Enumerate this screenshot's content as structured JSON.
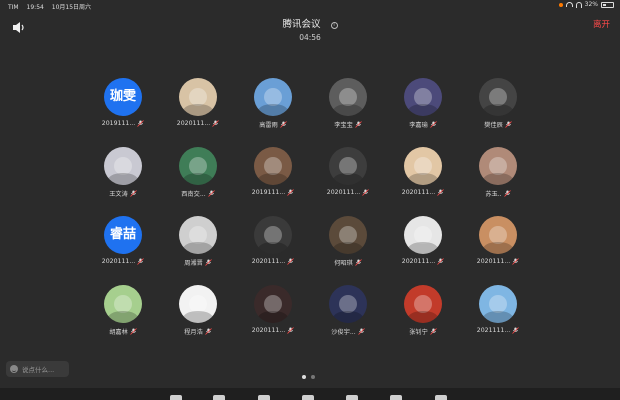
{
  "status": {
    "carrier": "TIM",
    "time": "19:54",
    "date": "10月15日周六",
    "battery": "32%"
  },
  "meeting": {
    "title": "腾讯会议",
    "timer": "04:56",
    "leave_label": "离开",
    "info_glyph": "i"
  },
  "colors": {
    "leave": "#ff4a4a",
    "initials_bg": "#1f72f0",
    "background": "#2b2b2b"
  },
  "participants": [
    {
      "name": "2019111...",
      "initials": "珈雯",
      "color": "#1f72f0"
    },
    {
      "name": "2020111...",
      "color": "#d8c3a5"
    },
    {
      "name": "高雷雨",
      "color": "#6a9fd6"
    },
    {
      "name": "李宝宝",
      "color": "#5d5d5d"
    },
    {
      "name": "李嘉瑜",
      "color": "#4c4a7a"
    },
    {
      "name": "樊佳辰",
      "color": "#444444"
    },
    {
      "name": "王文涛",
      "color": "#c9c9d2"
    },
    {
      "name": "西南交...",
      "color": "#3f7d57"
    },
    {
      "name": "2019111...",
      "color": "#7a5a45"
    },
    {
      "name": "2020111...",
      "color": "#3d3d3d"
    },
    {
      "name": "2020111...",
      "color": "#e2c7a5"
    },
    {
      "name": "苏玉..",
      "color": "#b08a78"
    },
    {
      "name": "2020111...",
      "initials": "睿喆",
      "color": "#1f72f0"
    },
    {
      "name": "周湘晋",
      "color": "#cfcfcf"
    },
    {
      "name": "2020111...",
      "color": "#3a3a3a"
    },
    {
      "name": "何昭琪",
      "color": "#5b4a3a"
    },
    {
      "name": "2020111...",
      "color": "#e6e6e6"
    },
    {
      "name": "2020111...",
      "color": "#c98f62"
    },
    {
      "name": "胡嘉林",
      "color": "#a6cf8e"
    },
    {
      "name": "程月浩",
      "color": "#f2f2f2"
    },
    {
      "name": "2020111...",
      "color": "#3a2a2a"
    },
    {
      "name": "沙俊宇...",
      "color": "#2d3358"
    },
    {
      "name": "张钊宁",
      "color": "#c23b2a"
    },
    {
      "name": "2021111...",
      "color": "#7fb6e3"
    }
  ],
  "chat": {
    "placeholder": "说点什么..."
  },
  "pager": {
    "pages": 2,
    "current": 1
  },
  "icons": {
    "speaker": "speaker-icon",
    "mic_muted": "mic-muted-icon",
    "emoji": "emoji-icon",
    "info": "info-icon"
  }
}
